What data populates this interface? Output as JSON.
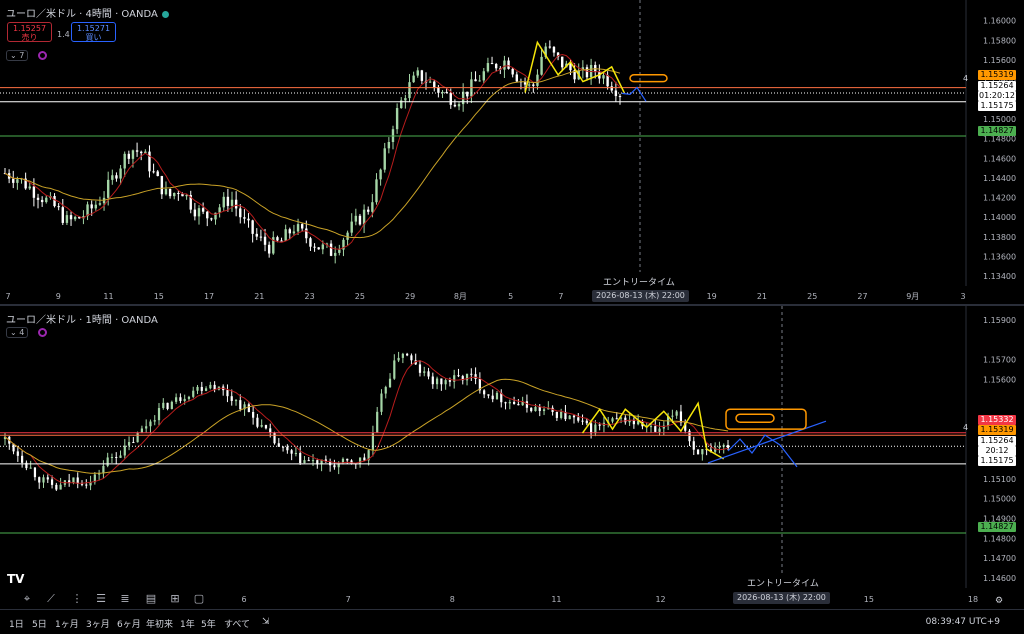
{
  "pane1": {
    "title": "ユーロ／米ドル · 4時間 · OANDA",
    "sell_price": "1.15257",
    "sell_label": "売り",
    "buy_price": "1.15271",
    "buy_label": "買い",
    "spread": "1.4",
    "indicator_count": "7",
    "price_ticks": [
      "1.16000",
      "1.15800",
      "1.15600",
      "1.15400",
      "1.15200",
      "1.15000",
      "1.14800",
      "1.14600",
      "1.14400",
      "1.14200",
      "1.14000",
      "1.13800",
      "1.13600",
      "1.13400"
    ],
    "date_ticks": [
      "7",
      "9",
      "11",
      "15",
      "17",
      "21",
      "23",
      "25",
      "29",
      "8月",
      "5",
      "7",
      "11",
      "15",
      "19",
      "21",
      "25",
      "27",
      "9月",
      "3"
    ],
    "tags": {
      "orange": "1.15319",
      "price": "1.15264",
      "countdown": "01:20:12",
      "white": "1.15175",
      "green": "1.14827"
    },
    "line_label": "4",
    "entry_label": "エントリータイム",
    "entry_date": "2026-08-13 (木)  22:00"
  },
  "pane2": {
    "title": "ユーロ／米ドル · 1時間 · OANDA",
    "indicator_count": "4",
    "price_ticks": [
      "1.15900",
      "1.15700",
      "1.15600",
      "1.15400",
      "1.15200",
      "1.15100",
      "1.15000",
      "1.14900",
      "1.14800",
      "1.14700",
      "1.14600"
    ],
    "date_ticks": [
      "6",
      "7",
      "8",
      "11",
      "12",
      "13",
      "15",
      "18"
    ],
    "tags": {
      "red": "1.15332",
      "orange": "1.15319",
      "price": "1.15264",
      "countdown": "20:12",
      "white": "1.15175",
      "green": "1.14827"
    },
    "line_label": "4",
    "entry_label": "エントリータイム",
    "entry_date": "2026-08-13 (木)  22:00"
  },
  "bottom_bar": {
    "timeframes": [
      "1日",
      "5日",
      "1ヶ月",
      "3ヶ月",
      "6ヶ月",
      "年初来",
      "1年",
      "5年",
      "すべて"
    ],
    "clock": "08:39:47 UTC+9"
  },
  "colors": {
    "up": "#a5d6a7",
    "down": "#ffffff",
    "ma_fast": "#b71c1c",
    "ma_slow": "#c9a227",
    "zigzag": "#f5e50a",
    "projection": "#2962ff",
    "orange": "#ff9800",
    "green_line": "#4caf50",
    "red_line": "#f23645"
  },
  "chart_data": [
    {
      "type": "candlestick",
      "title": "ユーロ／米ドル · 4時間 · OANDA",
      "x_ticks": [
        "7",
        "9",
        "11",
        "15",
        "17",
        "21",
        "23",
        "25",
        "29",
        "8月",
        "5",
        "7",
        "11",
        "15",
        "19",
        "21",
        "25",
        "27",
        "9月",
        "3"
      ],
      "ylim": [
        1.133,
        1.1615
      ],
      "close_path": [
        1.1445,
        1.144,
        1.143,
        1.142,
        1.141,
        1.1395,
        1.14,
        1.141,
        1.1425,
        1.145,
        1.147,
        1.1465,
        1.144,
        1.142,
        1.143,
        1.141,
        1.14,
        1.141,
        1.142,
        1.1395,
        1.138,
        1.137,
        1.1375,
        1.139,
        1.138,
        1.137,
        1.1365,
        1.138,
        1.1395,
        1.141,
        1.145,
        1.15,
        1.153,
        1.1545,
        1.1535,
        1.1525,
        1.152,
        1.153,
        1.1545,
        1.1555,
        1.156,
        1.154,
        1.153,
        1.1575,
        1.156,
        1.155,
        1.1545,
        1.155,
        1.154,
        1.1527
      ],
      "horizontal_levels": [
        1.15319,
        1.15264,
        1.15175,
        1.14827
      ],
      "moving_averages": [
        "fast (red)",
        "slow (gold)"
      ],
      "annotation": "エントリータイム 2026-08-13 (木) 22:00"
    },
    {
      "type": "candlestick",
      "title": "ユーロ／米ドル · 1時間 · OANDA",
      "x_ticks": [
        "6",
        "7",
        "8",
        "11",
        "12",
        "13",
        "15",
        "18"
      ],
      "ylim": [
        1.1455,
        1.1595
      ],
      "close_path": [
        1.153,
        1.152,
        1.151,
        1.1505,
        1.151,
        1.1508,
        1.152,
        1.1525,
        1.1535,
        1.1545,
        1.155,
        1.1555,
        1.1558,
        1.1552,
        1.1545,
        1.1535,
        1.1525,
        1.152,
        1.1518,
        1.1517,
        1.1518,
        1.152,
        1.1555,
        1.1575,
        1.1565,
        1.1558,
        1.156,
        1.1562,
        1.1553,
        1.155,
        1.1547,
        1.1545,
        1.1543,
        1.154,
        1.1535,
        1.1538,
        1.154,
        1.1537,
        1.1533,
        1.1545,
        1.1525,
        1.1522,
        1.1527
      ],
      "horizontal_levels": [
        1.15332,
        1.15319,
        1.15264,
        1.15175,
        1.14827
      ],
      "moving_averages": [
        "fast (red)",
        "slow (gold)"
      ],
      "annotation": "エントリータイム 2026-08-13 (木) 22:00"
    }
  ]
}
